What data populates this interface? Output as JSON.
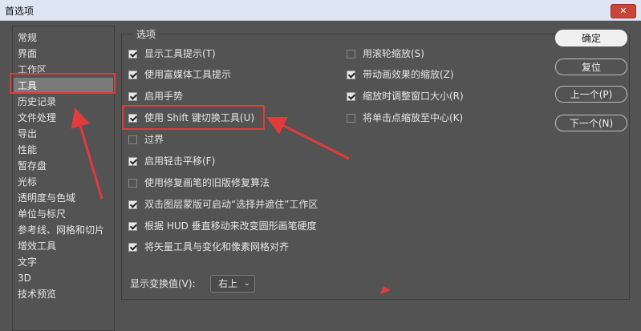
{
  "window": {
    "title": "首选项",
    "close_glyph": "✕"
  },
  "sidebar": {
    "items": [
      {
        "label": "常规"
      },
      {
        "label": "界面"
      },
      {
        "label": "工作区"
      },
      {
        "label": "工具"
      },
      {
        "label": "历史记录"
      },
      {
        "label": "文件处理"
      },
      {
        "label": "导出"
      },
      {
        "label": "性能"
      },
      {
        "label": "暂存盘"
      },
      {
        "label": "光标"
      },
      {
        "label": "透明度与色域"
      },
      {
        "label": "单位与标尺"
      },
      {
        "label": "参考线、网格和切片"
      },
      {
        "label": "增效工具"
      },
      {
        "label": "文字"
      },
      {
        "label": "3D"
      },
      {
        "label": "技术预览"
      }
    ],
    "selected": "工具"
  },
  "options": {
    "group_label": "选项",
    "left": [
      {
        "label": "显示工具提示(T)",
        "checked": true
      },
      {
        "label": "使用富媒体工具提示",
        "checked": true
      },
      {
        "label": "启用手势",
        "checked": true
      },
      {
        "label": "使用 Shift 键切换工具(U)",
        "checked": true
      },
      {
        "label": "过界",
        "checked": false
      },
      {
        "label": "启用轻击平移(F)",
        "checked": true
      },
      {
        "label": "使用修复画笔的旧版修复算法",
        "checked": false
      },
      {
        "label": "双击图层蒙版可启动“选择并遮住”工作区",
        "checked": true
      },
      {
        "label": "根据 HUD 垂直移动来改变圆形画笔硬度",
        "checked": true
      },
      {
        "label": "将矢量工具与变化和像素网格对齐",
        "checked": true
      }
    ],
    "right": [
      {
        "label": "用滚轮缩放(S)",
        "checked": false
      },
      {
        "label": "带动画效果的缩放(Z)",
        "checked": true
      },
      {
        "label": "缩放时调整窗口大小(R)",
        "checked": true
      },
      {
        "label": "将单击点缩放至中心(K)",
        "checked": false
      }
    ],
    "transform_value": {
      "label": "显示变换值(V):",
      "value": "右上",
      "arrow": "⌄"
    }
  },
  "buttons": {
    "ok": "确定",
    "reset": "复位",
    "prev": "上一个(P)",
    "next": "下一个(N)"
  },
  "annotation_color": "#e33b3b"
}
